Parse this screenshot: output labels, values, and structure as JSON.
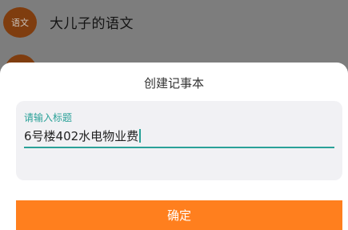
{
  "background_list": {
    "row1": {
      "avatar_text": "语文",
      "title": "大儿子的语文"
    }
  },
  "dialog": {
    "title": "创建记事本",
    "input": {
      "label": "请输入标题",
      "value": "6号楼402水电物业费"
    },
    "confirm_label": "确定"
  },
  "colors": {
    "accent": "#2aa198",
    "button": "#ff7f1e",
    "avatar": "#7f3d0f",
    "overlay": "#7d7d7d"
  }
}
